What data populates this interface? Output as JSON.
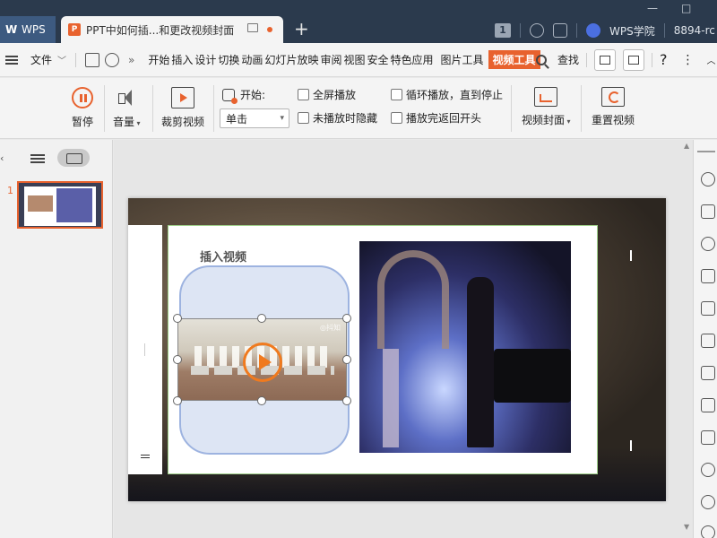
{
  "titlebar": {
    "app_tab_label": "WPS",
    "doc_tab_title": "PPT中如何插...和更改视频封面",
    "badge_count": "1",
    "academy_label": "WPS学院",
    "user_label": "8894-rc"
  },
  "menubar": {
    "file_label": "文件",
    "items": [
      "开始",
      "插入",
      "设计",
      "切换",
      "动画",
      "幻灯片放映",
      "审阅",
      "视图",
      "安全",
      "特色应用",
      "图片工具"
    ],
    "active_item": "视频工具",
    "search_label": "查找",
    "help_label": "?"
  },
  "ribbon": {
    "pause_label": "暂停",
    "volume_label": "音量",
    "trim_label": "裁剪视频",
    "start_label": "开始:",
    "start_value": "单击",
    "fullscreen_label": "全屏播放",
    "hide_label": "未播放时隐藏",
    "loop_label": "循环播放，直到停止",
    "rewind_label": "播放完返回开头",
    "cover_label": "视频封面",
    "reset_label": "重置视频"
  },
  "leftpanel": {
    "slide_number": "1"
  },
  "slide": {
    "insert_title": "插入视频",
    "watermark": "◎抖知"
  },
  "colors": {
    "accent": "#e8622e",
    "titlebar_bg": "#2b3a4d",
    "frame_border": "#9db3e0"
  }
}
